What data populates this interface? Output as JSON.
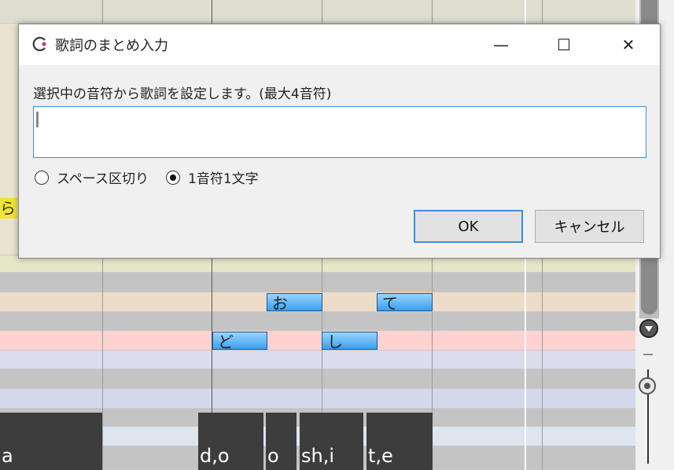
{
  "dialog": {
    "title": "歌詞のまとめ入力",
    "prompt": "選択中の音符から歌詞を設定します。(最大4音符)",
    "input_value": "",
    "options": {
      "space_split": "スペース区切り",
      "one_char": "1音符1文字",
      "selected": "one_char"
    },
    "ok_label": "OK",
    "cancel_label": "キャンセル",
    "minimize_glyph": "—",
    "maximize_glyph": "☐",
    "close_glyph": "✕"
  },
  "piano_roll": {
    "side_label": "ら",
    "notes": [
      "お",
      "て",
      "ど",
      "し"
    ],
    "phonemes": [
      "a",
      "d,o",
      "o",
      "sh,i",
      "t,e"
    ]
  },
  "colors": {
    "accent": "#3c8edc",
    "note_fill": "#5ab4f4",
    "lane_pink": "#ffd2d2",
    "lane_beige": "#ecdcc8",
    "lane_gray": "#c4c4c4",
    "lane_lavender": "#dcdcec"
  }
}
